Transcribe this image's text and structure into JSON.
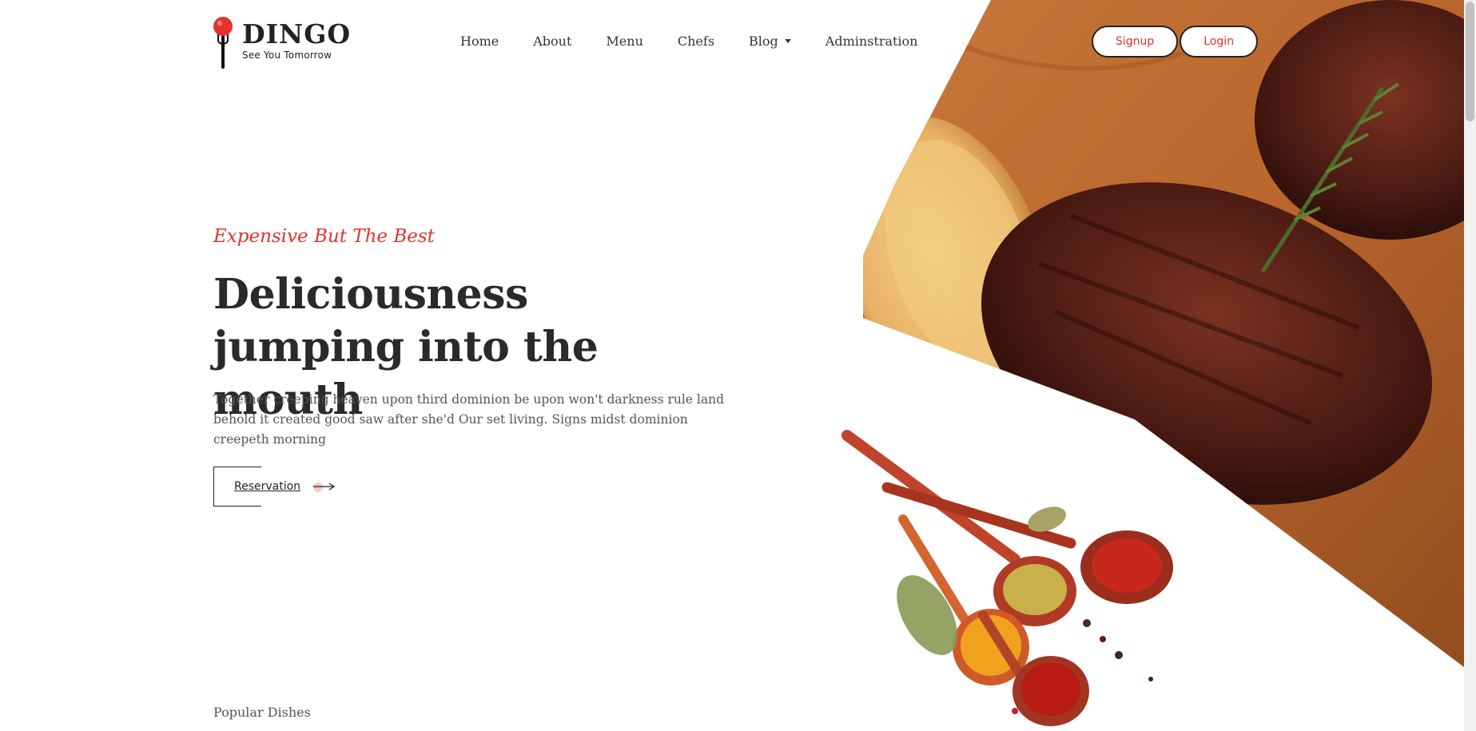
{
  "brand": {
    "name": "DINGO",
    "tagline": "See You Tomorrow"
  },
  "nav": {
    "items": [
      {
        "label": "Home"
      },
      {
        "label": "About"
      },
      {
        "label": "Menu"
      },
      {
        "label": "Chefs"
      },
      {
        "label": "Blog"
      },
      {
        "label": "Adminstration"
      }
    ]
  },
  "auth": {
    "signup_label": "Signup",
    "login_label": "Login"
  },
  "hero": {
    "subtitle": "Expensive But The Best",
    "title": "Deliciousness jumping into the mouth",
    "text": "Together creeping heaven upon third dominion be upon won't darkness rule land behold it created good saw after she'd Our set living. Signs midst dominion creepeth morning",
    "cta_label": "Reservation"
  },
  "section": {
    "popular_label": "Popular Dishes"
  },
  "colors": {
    "accent": "#e5322d",
    "text_dark": "#2a2a2a"
  }
}
